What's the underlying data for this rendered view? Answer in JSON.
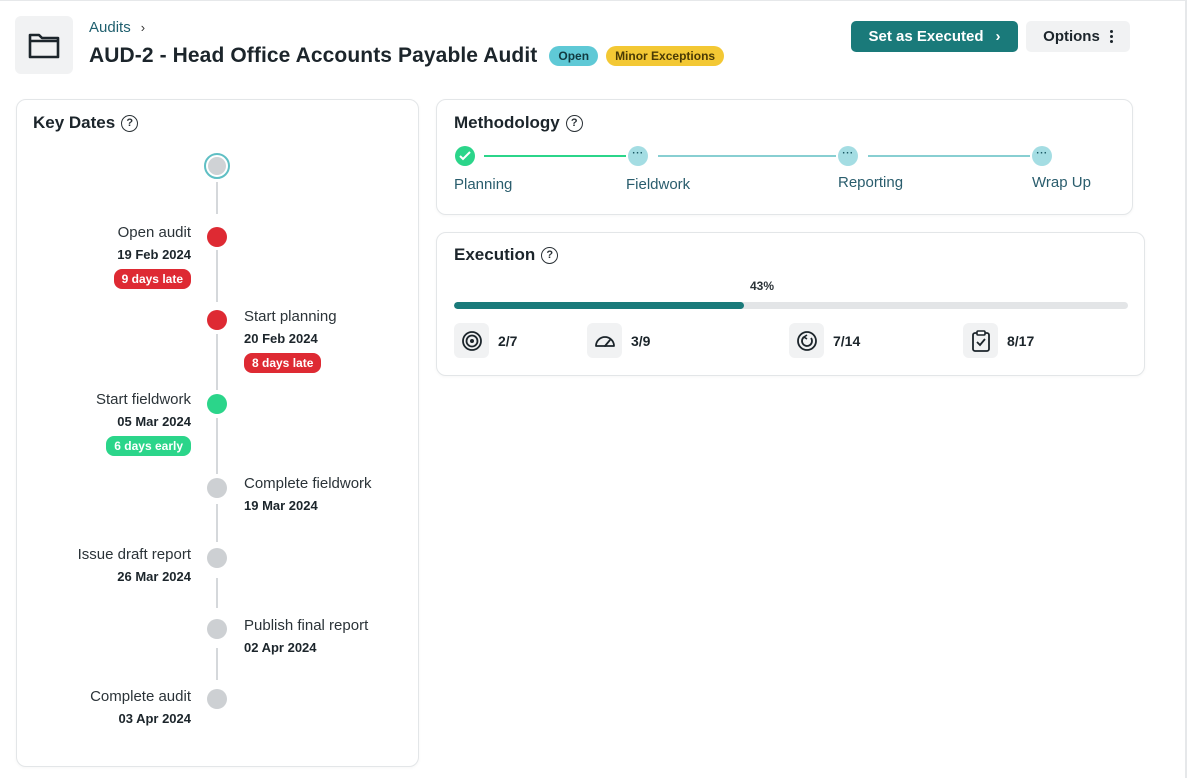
{
  "header": {
    "folder_icon": "folder-icon",
    "breadcrumb": {
      "parent": "Audits",
      "separator": "›"
    },
    "title": "AUD-2 - Head Office Accounts Payable Audit",
    "badges": {
      "status": "Open",
      "exceptions": "Minor Exceptions"
    },
    "actions": {
      "execute_label": "Set as Executed",
      "execute_chevron": "›",
      "options_label": "Options"
    }
  },
  "key_dates": {
    "title": "Key Dates",
    "help": "?",
    "events": [
      {
        "label": "Open audit",
        "date": "19 Feb 2024",
        "status": "late",
        "pill": "9 days late",
        "side": "left"
      },
      {
        "label": "Start planning",
        "date": "20 Feb 2024",
        "status": "late",
        "pill": "8 days late",
        "side": "right"
      },
      {
        "label": "Start fieldwork",
        "date": "05 Mar 2024",
        "status": "early",
        "pill": "6 days early",
        "side": "left"
      },
      {
        "label": "Complete fieldwork",
        "date": "19 Mar 2024",
        "status": "pending",
        "pill": "",
        "side": "right"
      },
      {
        "label": "Issue draft report",
        "date": "26 Mar 2024",
        "status": "pending",
        "pill": "",
        "side": "left"
      },
      {
        "label": "Publish final report",
        "date": "02 Apr 2024",
        "status": "pending",
        "pill": "",
        "side": "right"
      },
      {
        "label": "Complete audit",
        "date": "03 Apr 2024",
        "status": "pending",
        "pill": "",
        "side": "left"
      }
    ]
  },
  "methodology": {
    "title": "Methodology",
    "help": "?",
    "steps": [
      {
        "label": "Planning",
        "state": "done"
      },
      {
        "label": "Fieldwork",
        "state": "pending",
        "glyph": "···"
      },
      {
        "label": "Reporting",
        "state": "pending",
        "glyph": "···"
      },
      {
        "label": "Wrap Up",
        "state": "pending",
        "glyph": "···"
      }
    ]
  },
  "execution": {
    "title": "Execution",
    "help": "?",
    "progress_label": "43%",
    "progress_fraction": 0.43,
    "stats": [
      {
        "icon": "target-icon",
        "value": "2/7"
      },
      {
        "icon": "gauge-icon",
        "value": "3/9"
      },
      {
        "icon": "cycle-icon",
        "value": "7/14"
      },
      {
        "icon": "clipboard-check-icon",
        "value": "8/17"
      }
    ]
  },
  "colors": {
    "accent": "#1a7a7a",
    "late": "#de2a33",
    "early": "#2bd58a",
    "pending": "#cdd0d3",
    "badge_open": "#5fc9d6",
    "badge_minor": "#f3c834"
  }
}
